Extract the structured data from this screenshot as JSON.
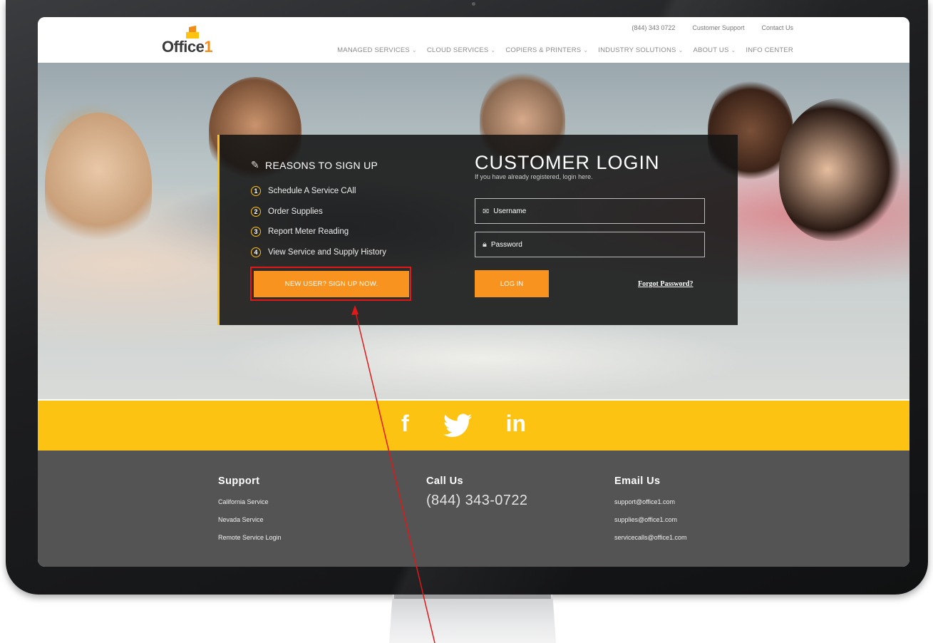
{
  "header": {
    "logo": {
      "text_main": "Office",
      "text_accent": "1"
    },
    "utility_nav": [
      "(844) 343 0722",
      "Customer Support",
      "Contact Us"
    ],
    "main_nav": [
      {
        "label": "MANAGED SERVICES",
        "dropdown": true
      },
      {
        "label": "CLOUD SERVICES",
        "dropdown": true
      },
      {
        "label": "COPIERS & PRINTERS",
        "dropdown": true
      },
      {
        "label": "INDUSTRY SOLUTIONS",
        "dropdown": true
      },
      {
        "label": "ABOUT US",
        "dropdown": true
      },
      {
        "label": "INFO CENTER",
        "dropdown": false
      }
    ]
  },
  "reasons": {
    "title": "REASONS TO SIGN UP",
    "items": [
      {
        "num": "1",
        "label": "Schedule A Service CAll"
      },
      {
        "num": "2",
        "label": "Order Supplies"
      },
      {
        "num": "3",
        "label": "Report Meter Reading"
      },
      {
        "num": "4",
        "label": "View Service and Supply History"
      }
    ],
    "signup_button": "NEW USER? SIGN UP NOW."
  },
  "login": {
    "title": "CUSTOMER LOGIN",
    "subtitle": "If you have already registered, login here.",
    "username_placeholder": "Username",
    "password_placeholder": "Password",
    "login_button": "LOG IN",
    "forgot_link": "Forgot Password?"
  },
  "social": {
    "icons": [
      {
        "icon": "facebook-icon",
        "glyph": "f"
      },
      {
        "icon": "twitter-icon",
        "glyph": "🐦"
      },
      {
        "icon": "linkedin-icon",
        "glyph": "in"
      }
    ]
  },
  "footer": {
    "support": {
      "heading": "Support",
      "links": [
        "California Service",
        "Nevada Service",
        "Remote Service Login"
      ]
    },
    "call": {
      "heading": "Call Us",
      "phone": "(844) 343-0722"
    },
    "email": {
      "heading": "Email Us",
      "links": [
        "support@office1.com",
        "supplies@office1.com",
        "servicecalls@office1.com"
      ]
    }
  },
  "colors": {
    "accent_orange": "#f7931e",
    "accent_yellow": "#fdc313",
    "highlight_red": "#e01818",
    "footer_bg": "#545454"
  }
}
